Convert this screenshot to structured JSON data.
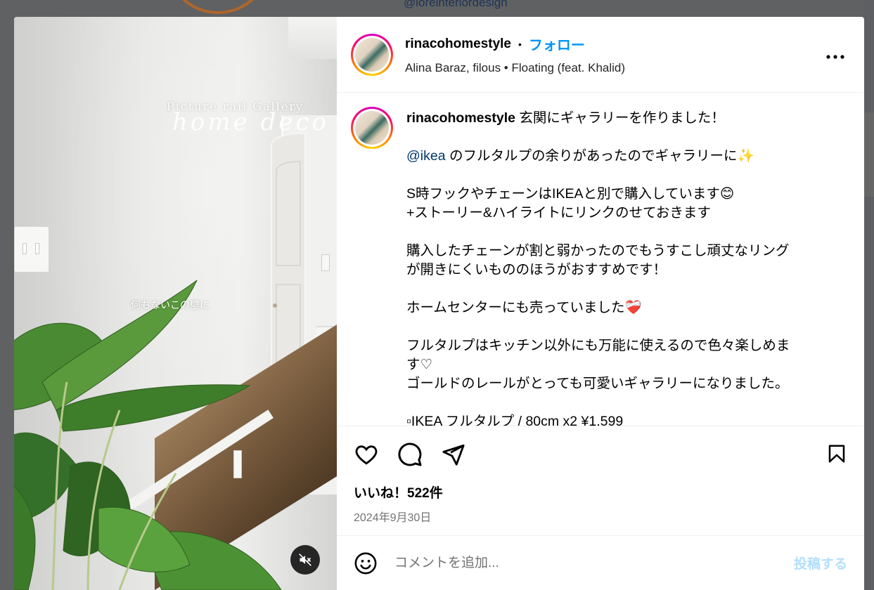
{
  "background": {
    "username": "@loreinteriordesign"
  },
  "media": {
    "overlay_title": "Picture rail Gallery",
    "overlay_script": "home deco",
    "overlay_caption": "何もないこの壁に",
    "mute_icon": "speaker-muted-icon"
  },
  "header": {
    "username": "rinacohomestyle",
    "separator": "•",
    "follow_label": "フォロー",
    "music": "Alina Baraz, filous • Floating (feat. Khalid)",
    "more_icon": "more-horizontal-icon"
  },
  "caption": {
    "username": "rinacohomestyle",
    "first_line": "玄関にギャラリーを作りました！",
    "mention": "@ikea",
    "mention_rest": "のフルタルプの余りがあったのでギャラリーに✨",
    "line3": "S時フックやチェーンはIKEAと別で購入しています😊",
    "line4": "+ストーリー&ハイライトにリンクのせておきます",
    "line5": "購入したチェーンが割と弱かったのでもうすこし頑丈なリング",
    "line6": "が開きにくいもののほうがおすすめです！",
    "line7": "ホームセンターにも売っていました❤️‍🩹",
    "line8": "フルタルプはキッチン以外にも万能に使えるので色々楽しめま",
    "line9": "す♡",
    "line10": "ゴールドのレールがとっても可愛いギャラリーになりました。",
    "line11": "▫IKEA フルタルプ / 80cm x2 ¥1,599"
  },
  "actions": {
    "like_icon": "heart-icon",
    "comment_icon": "comment-icon",
    "share_icon": "share-icon",
    "save_icon": "bookmark-icon",
    "likes": "いいね！522件",
    "date": "2024年9月30日"
  },
  "comment_bar": {
    "emoji_icon": "emoji-icon",
    "placeholder": "コメントを追加...",
    "post_label": "投稿する"
  },
  "colors": {
    "accent": "#0095f6",
    "mention": "#00376b",
    "post_disabled": "#b2dffc"
  }
}
